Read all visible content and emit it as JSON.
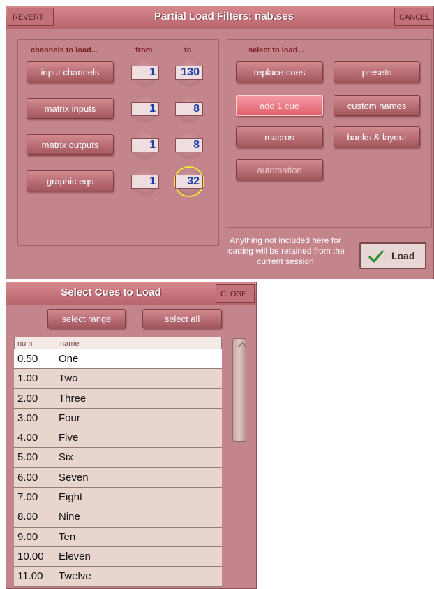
{
  "dialog": {
    "title": "Partial Load Filters: nab.ses",
    "revert_label": "REVERT",
    "cancel_label": "CANCEL"
  },
  "channels": {
    "heading": "channels to load...",
    "from_heading": "from",
    "to_heading": "to",
    "rows": [
      {
        "label": "input channels",
        "from": "1",
        "to": "130"
      },
      {
        "label": "matrix inputs",
        "from": "1",
        "to": "8"
      },
      {
        "label": "matrix outputs",
        "from": "1",
        "to": "8"
      },
      {
        "label": "graphic eqs",
        "from": "1",
        "to": "32"
      }
    ]
  },
  "select": {
    "heading": "select to load...",
    "buttons": {
      "replace_cues": "replace cues",
      "presets": "presets",
      "add_cue": "add 1 cue",
      "custom_names": "custom names",
      "macros": "macros",
      "banks_layout": "banks & layout",
      "automation": "automation"
    }
  },
  "note": "Anything not included here for loading will be retained from the current session",
  "load_label": "Load",
  "cues": {
    "title": "Select Cues to Load",
    "close_label": "CLOSE",
    "select_range_label": "select range",
    "select_all_label": "select all",
    "col_num": "num",
    "col_name": "name",
    "rows": [
      {
        "num": "0.50",
        "name": "One"
      },
      {
        "num": "1.00",
        "name": "Two"
      },
      {
        "num": "2.00",
        "name": "Three"
      },
      {
        "num": "3.00",
        "name": "Four"
      },
      {
        "num": "4.00",
        "name": "Five"
      },
      {
        "num": "5.00",
        "name": "Six"
      },
      {
        "num": "6.00",
        "name": "Seven"
      },
      {
        "num": "7.00",
        "name": "Eight"
      },
      {
        "num": "8.00",
        "name": "Nine"
      },
      {
        "num": "9.00",
        "name": "Ten"
      },
      {
        "num": "10.00",
        "name": "Eleven"
      },
      {
        "num": "11.00",
        "name": "Twelve"
      }
    ]
  },
  "colors": {
    "panel": "#c4848b",
    "titlebar": "#b8646c",
    "number_text": "#1f3ea8",
    "highlight_ring": "#f4e83a",
    "check_green": "#2f8a2a"
  },
  "icons": {
    "load": "check-icon",
    "scroll": "scroll-up-arrow-icon"
  }
}
